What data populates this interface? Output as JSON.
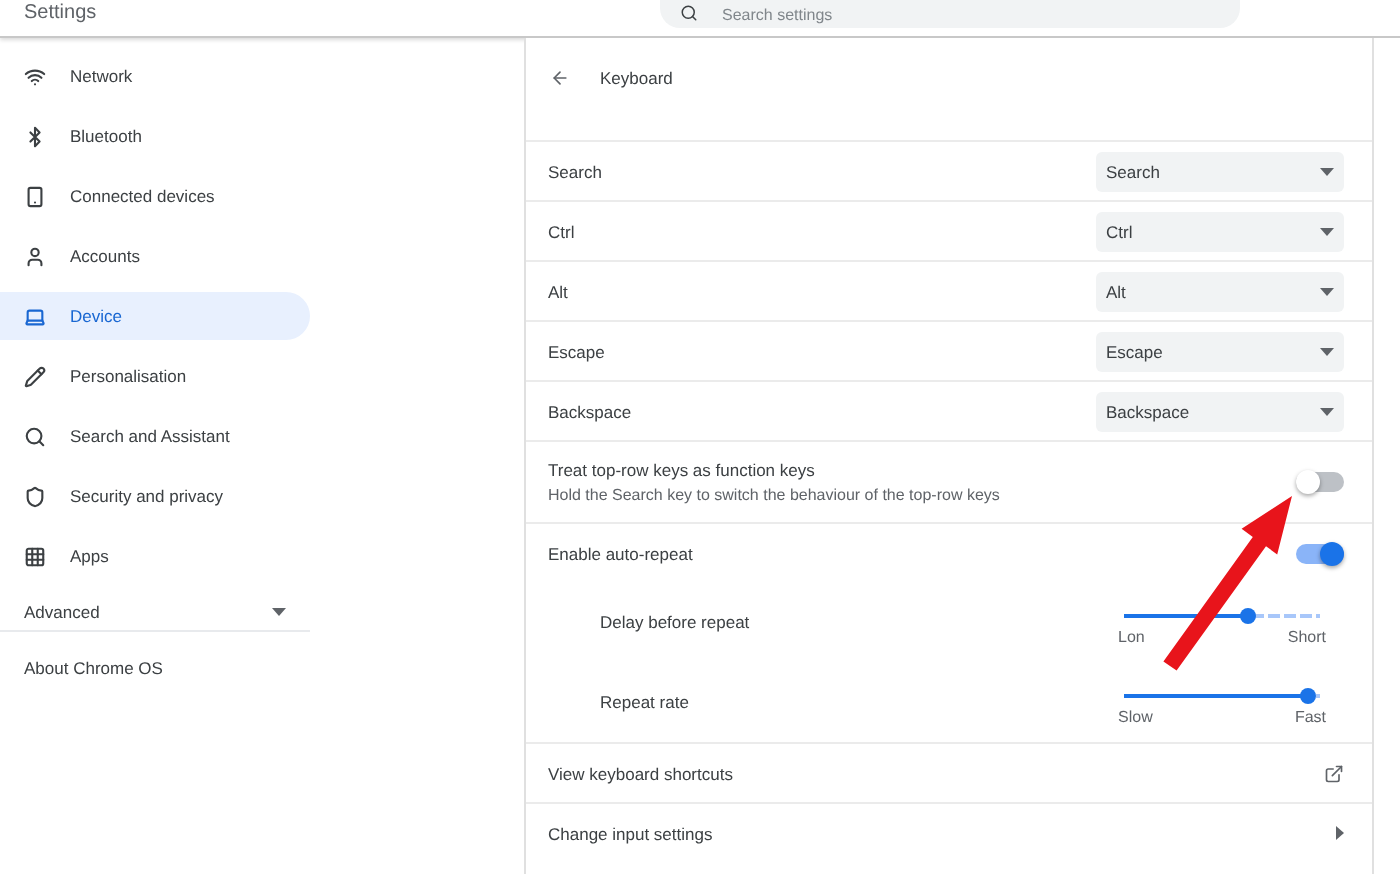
{
  "header": {
    "title": "Settings",
    "search": {
      "placeholder": "Search settings"
    }
  },
  "sidebar": {
    "items": [
      {
        "label": "Network",
        "selected": false
      },
      {
        "label": "Bluetooth",
        "selected": false
      },
      {
        "label": "Connected devices",
        "selected": false
      },
      {
        "label": "Accounts",
        "selected": false
      },
      {
        "label": "Device",
        "selected": true
      },
      {
        "label": "Personalisation",
        "selected": false
      },
      {
        "label": "Search and Assistant",
        "selected": false
      },
      {
        "label": "Security and privacy",
        "selected": false
      },
      {
        "label": "Apps",
        "selected": false
      }
    ],
    "advanced": {
      "label": "Advanced",
      "expanded": false
    },
    "about": "About Chrome OS"
  },
  "page": {
    "title": "Keyboard",
    "remaps": [
      {
        "label": "Search",
        "value": "Search"
      },
      {
        "label": "Ctrl",
        "value": "Ctrl"
      },
      {
        "label": "Alt",
        "value": "Alt"
      },
      {
        "label": "Escape",
        "value": "Escape"
      },
      {
        "label": "Backspace",
        "value": "Backspace"
      }
    ],
    "toggles": [
      {
        "label": "Treat top-row keys as function keys",
        "description": "Hold the Search key to switch the behaviour of the top-row keys",
        "on": false
      },
      {
        "label": "Enable auto-repeat",
        "on": true
      }
    ],
    "sliders": [
      {
        "label": "Delay before repeat",
        "level": 0.63,
        "min_label": "Lon",
        "max_label": "Short"
      },
      {
        "label": "Repeat rate",
        "level": 0.94,
        "min_label": "Slow",
        "max_label": "Fast"
      }
    ],
    "links": [
      {
        "label": "View keyboard shortcuts",
        "kind": "external"
      },
      {
        "label": "Change input settings",
        "kind": "submenu"
      }
    ]
  }
}
